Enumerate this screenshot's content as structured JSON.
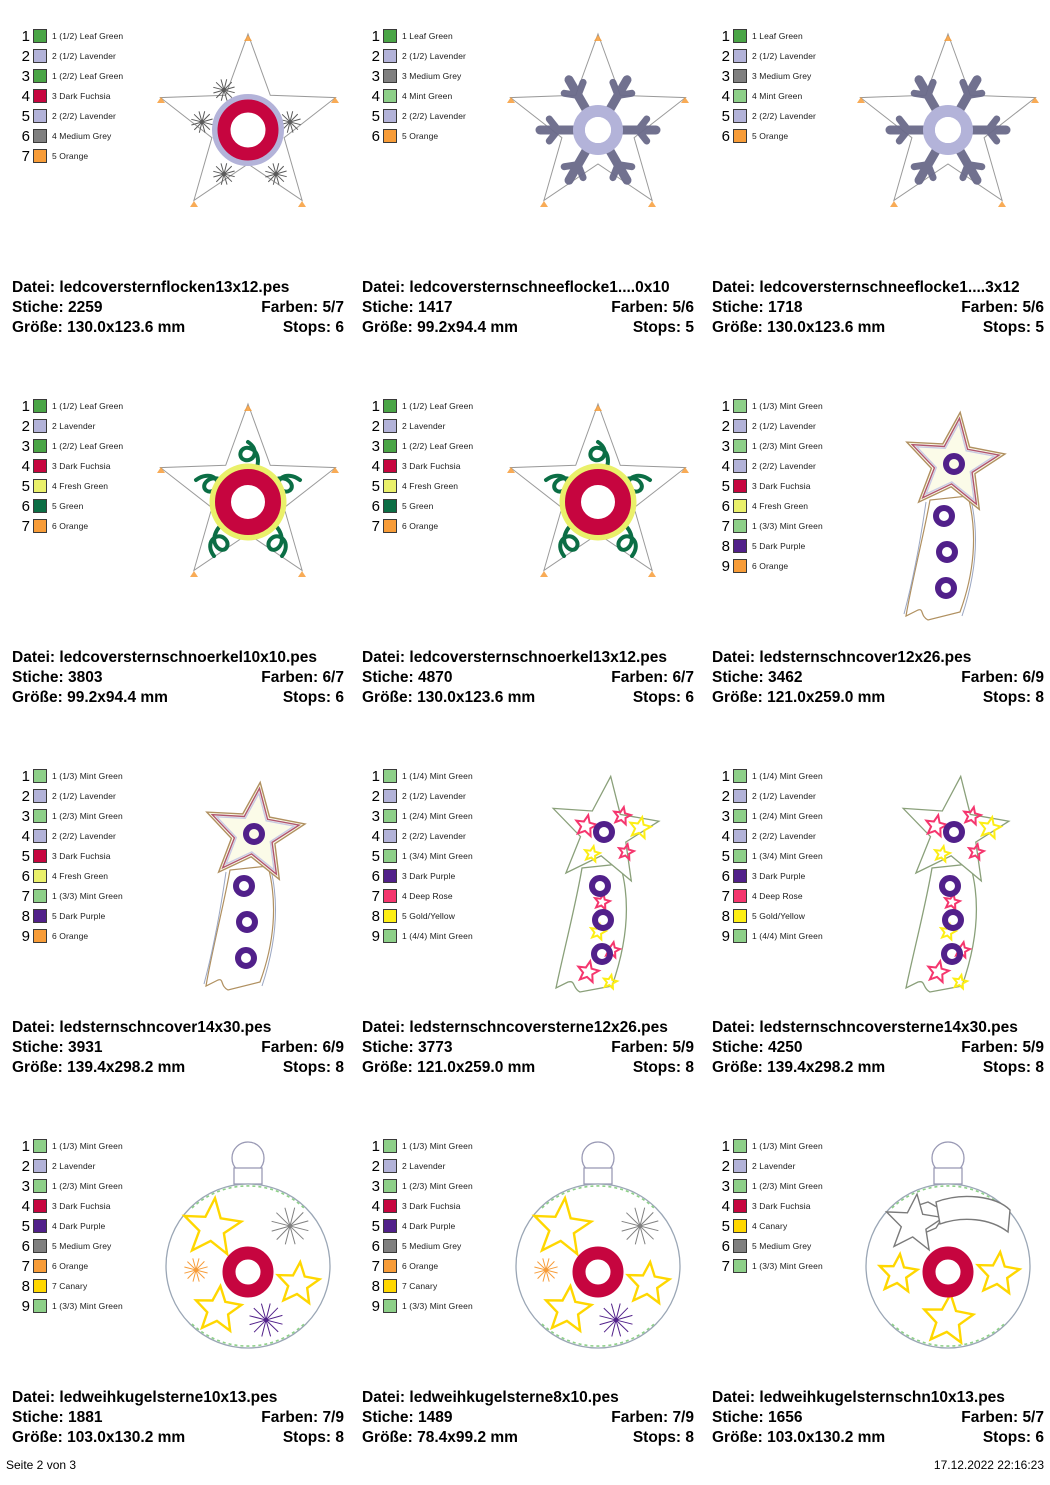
{
  "footer": {
    "page": "Seite 2 von 3",
    "timestamp": "17.12.2022 22:16:23"
  },
  "labels": {
    "file": "Datei:",
    "stitches": "Stiche:",
    "colors": "Farben:",
    "size": "Größe:",
    "stops": "Stops:"
  },
  "palette": {
    "leaf_green": "#4aa546",
    "mint_green": "#8ed089",
    "lavender": "#b3b3d9",
    "medium_grey": "#808080",
    "dark_fuchsia": "#c6053f",
    "fresh_green": "#eaf06a",
    "green": "#0b6e45",
    "dark_purple": "#51208a",
    "orange": "#f79c38",
    "deep_rose": "#f5366e",
    "gold_yellow": "#fdee14",
    "canary": "#ffd700"
  },
  "designs": [
    {
      "art": "star-flakes",
      "file": "ledcoversternflocken13x12.pes",
      "stitches": "2259",
      "colors": "5/7",
      "size": "130.0x123.6 mm",
      "stops": "6",
      "legend": [
        {
          "n": "1",
          "color": "#4aa546",
          "text": "1 (1/2) Leaf Green"
        },
        {
          "n": "2",
          "color": "#b3b3d9",
          "text": "2 (1/2) Lavender"
        },
        {
          "n": "3",
          "color": "#4aa546",
          "text": "1 (2/2) Leaf Green"
        },
        {
          "n": "4",
          "color": "#c6053f",
          "text": "3 Dark Fuchsia"
        },
        {
          "n": "5",
          "color": "#b3b3d9",
          "text": "2 (2/2) Lavender"
        },
        {
          "n": "6",
          "color": "#808080",
          "text": "4 Medium Grey"
        },
        {
          "n": "7",
          "color": "#f79c38",
          "text": "5 Orange"
        }
      ]
    },
    {
      "art": "star-snowflake",
      "file": "ledcoversternschneeflocke1....0x10",
      "stitches": "1417",
      "colors": "5/6",
      "size": "99.2x94.4 mm",
      "stops": "5",
      "legend": [
        {
          "n": "1",
          "color": "#4aa546",
          "text": "1 Leaf Green"
        },
        {
          "n": "2",
          "color": "#b3b3d9",
          "text": "2 (1/2) Lavender"
        },
        {
          "n": "3",
          "color": "#808080",
          "text": "3 Medium Grey"
        },
        {
          "n": "4",
          "color": "#8ed089",
          "text": "4 Mint Green"
        },
        {
          "n": "5",
          "color": "#b3b3d9",
          "text": "2 (2/2) Lavender"
        },
        {
          "n": "6",
          "color": "#f79c38",
          "text": "5 Orange"
        }
      ]
    },
    {
      "art": "star-snowflake",
      "file": "ledcoversternschneeflocke1....3x12",
      "stitches": "1718",
      "colors": "5/6",
      "size": "130.0x123.6 mm",
      "stops": "5",
      "legend": [
        {
          "n": "1",
          "color": "#4aa546",
          "text": "1 Leaf Green"
        },
        {
          "n": "2",
          "color": "#b3b3d9",
          "text": "2 (1/2) Lavender"
        },
        {
          "n": "3",
          "color": "#808080",
          "text": "3 Medium Grey"
        },
        {
          "n": "4",
          "color": "#8ed089",
          "text": "4 Mint Green"
        },
        {
          "n": "5",
          "color": "#b3b3d9",
          "text": "2 (2/2) Lavender"
        },
        {
          "n": "6",
          "color": "#f79c38",
          "text": "5 Orange"
        }
      ]
    },
    {
      "art": "star-swirls",
      "file": "ledcoversternschnoerkel10x10.pes",
      "stitches": "3803",
      "colors": "6/7",
      "size": "99.2x94.4 mm",
      "stops": "6",
      "legend": [
        {
          "n": "1",
          "color": "#4aa546",
          "text": "1 (1/2) Leaf Green"
        },
        {
          "n": "2",
          "color": "#b3b3d9",
          "text": "2 Lavender"
        },
        {
          "n": "3",
          "color": "#4aa546",
          "text": "1 (2/2) Leaf Green"
        },
        {
          "n": "4",
          "color": "#c6053f",
          "text": "3 Dark Fuchsia"
        },
        {
          "n": "5",
          "color": "#eaf06a",
          "text": "4 Fresh Green"
        },
        {
          "n": "6",
          "color": "#0b6e45",
          "text": "5 Green"
        },
        {
          "n": "7",
          "color": "#f79c38",
          "text": "6 Orange"
        }
      ]
    },
    {
      "art": "star-swirls",
      "file": "ledcoversternschnoerkel13x12.pes",
      "stitches": "4870",
      "colors": "6/7",
      "size": "130.0x123.6 mm",
      "stops": "6",
      "legend": [
        {
          "n": "1",
          "color": "#4aa546",
          "text": "1 (1/2) Leaf Green"
        },
        {
          "n": "2",
          "color": "#b3b3d9",
          "text": "2 Lavender"
        },
        {
          "n": "3",
          "color": "#4aa546",
          "text": "1 (2/2) Leaf Green"
        },
        {
          "n": "4",
          "color": "#c6053f",
          "text": "3 Dark Fuchsia"
        },
        {
          "n": "5",
          "color": "#eaf06a",
          "text": "4 Fresh Green"
        },
        {
          "n": "6",
          "color": "#0b6e45",
          "text": "5 Green"
        },
        {
          "n": "7",
          "color": "#f79c38",
          "text": "6 Orange"
        }
      ]
    },
    {
      "art": "shooting-star-plain",
      "file": "ledsternschncover12x26.pes",
      "stitches": "3462",
      "colors": "6/9",
      "size": "121.0x259.0 mm",
      "stops": "8",
      "legend": [
        {
          "n": "1",
          "color": "#8ed089",
          "text": "1 (1/3) Mint Green"
        },
        {
          "n": "2",
          "color": "#b3b3d9",
          "text": "2 (1/2) Lavender"
        },
        {
          "n": "3",
          "color": "#8ed089",
          "text": "1 (2/3) Mint Green"
        },
        {
          "n": "4",
          "color": "#b3b3d9",
          "text": "2 (2/2) Lavender"
        },
        {
          "n": "5",
          "color": "#c6053f",
          "text": "3 Dark Fuchsia"
        },
        {
          "n": "6",
          "color": "#eaf06a",
          "text": "4 Fresh Green"
        },
        {
          "n": "7",
          "color": "#8ed089",
          "text": "1 (3/3) Mint Green"
        },
        {
          "n": "8",
          "color": "#51208a",
          "text": "5 Dark Purple"
        },
        {
          "n": "9",
          "color": "#f79c38",
          "text": "6 Orange"
        }
      ]
    },
    {
      "art": "shooting-star-plain",
      "file": "ledsternschncover14x30.pes",
      "stitches": "3931",
      "colors": "6/9",
      "size": "139.4x298.2 mm",
      "stops": "8",
      "legend": [
        {
          "n": "1",
          "color": "#8ed089",
          "text": "1 (1/3) Mint Green"
        },
        {
          "n": "2",
          "color": "#b3b3d9",
          "text": "2 (1/2) Lavender"
        },
        {
          "n": "3",
          "color": "#8ed089",
          "text": "1 (2/3) Mint Green"
        },
        {
          "n": "4",
          "color": "#b3b3d9",
          "text": "2 (2/2) Lavender"
        },
        {
          "n": "5",
          "color": "#c6053f",
          "text": "3 Dark Fuchsia"
        },
        {
          "n": "6",
          "color": "#eaf06a",
          "text": "4 Fresh Green"
        },
        {
          "n": "7",
          "color": "#8ed089",
          "text": "1 (3/3) Mint Green"
        },
        {
          "n": "8",
          "color": "#51208a",
          "text": "5 Dark Purple"
        },
        {
          "n": "9",
          "color": "#f79c38",
          "text": "6 Orange"
        }
      ]
    },
    {
      "art": "shooting-star-stars",
      "file": "ledsternschncoversterne12x26.pes",
      "stitches": "3773",
      "colors": "5/9",
      "size": "121.0x259.0 mm",
      "stops": "8",
      "legend": [
        {
          "n": "1",
          "color": "#8ed089",
          "text": "1 (1/4) Mint Green"
        },
        {
          "n": "2",
          "color": "#b3b3d9",
          "text": "2 (1/2) Lavender"
        },
        {
          "n": "3",
          "color": "#8ed089",
          "text": "1 (2/4) Mint Green"
        },
        {
          "n": "4",
          "color": "#b3b3d9",
          "text": "2 (2/2) Lavender"
        },
        {
          "n": "5",
          "color": "#8ed089",
          "text": "1 (3/4) Mint Green"
        },
        {
          "n": "6",
          "color": "#51208a",
          "text": "3 Dark Purple"
        },
        {
          "n": "7",
          "color": "#f5366e",
          "text": "4 Deep Rose"
        },
        {
          "n": "8",
          "color": "#fdee14",
          "text": "5 Gold/Yellow"
        },
        {
          "n": "9",
          "color": "#8ed089",
          "text": "1 (4/4) Mint Green"
        }
      ]
    },
    {
      "art": "shooting-star-stars",
      "file": "ledsternschncoversterne14x30.pes",
      "stitches": "4250",
      "colors": "5/9",
      "size": "139.4x298.2 mm",
      "stops": "8",
      "legend": [
        {
          "n": "1",
          "color": "#8ed089",
          "text": "1 (1/4) Mint Green"
        },
        {
          "n": "2",
          "color": "#b3b3d9",
          "text": "2 (1/2) Lavender"
        },
        {
          "n": "3",
          "color": "#8ed089",
          "text": "1 (2/4) Mint Green"
        },
        {
          "n": "4",
          "color": "#b3b3d9",
          "text": "2 (2/2) Lavender"
        },
        {
          "n": "5",
          "color": "#8ed089",
          "text": "1 (3/4) Mint Green"
        },
        {
          "n": "6",
          "color": "#51208a",
          "text": "3 Dark Purple"
        },
        {
          "n": "7",
          "color": "#f5366e",
          "text": "4 Deep Rose"
        },
        {
          "n": "8",
          "color": "#fdee14",
          "text": "5 Gold/Yellow"
        },
        {
          "n": "9",
          "color": "#8ed089",
          "text": "1 (4/4) Mint Green"
        }
      ]
    },
    {
      "art": "bauble-stars",
      "file": "ledweihkugelsterne10x13.pes",
      "stitches": "1881",
      "colors": "7/9",
      "size": "103.0x130.2 mm",
      "stops": "8",
      "legend": [
        {
          "n": "1",
          "color": "#8ed089",
          "text": "1 (1/3) Mint Green"
        },
        {
          "n": "2",
          "color": "#b3b3d9",
          "text": "2 Lavender"
        },
        {
          "n": "3",
          "color": "#8ed089",
          "text": "1 (2/3) Mint Green"
        },
        {
          "n": "4",
          "color": "#c6053f",
          "text": "3 Dark Fuchsia"
        },
        {
          "n": "5",
          "color": "#51208a",
          "text": "4 Dark Purple"
        },
        {
          "n": "6",
          "color": "#808080",
          "text": "5 Medium Grey"
        },
        {
          "n": "7",
          "color": "#f79c38",
          "text": "6 Orange"
        },
        {
          "n": "8",
          "color": "#ffd700",
          "text": "7 Canary"
        },
        {
          "n": "9",
          "color": "#8ed089",
          "text": "1 (3/3) Mint Green"
        }
      ]
    },
    {
      "art": "bauble-stars",
      "file": "ledweihkugelsterne8x10.pes",
      "stitches": "1489",
      "colors": "7/9",
      "size": "78.4x99.2 mm",
      "stops": "8",
      "legend": [
        {
          "n": "1",
          "color": "#8ed089",
          "text": "1 (1/3) Mint Green"
        },
        {
          "n": "2",
          "color": "#b3b3d9",
          "text": "2 Lavender"
        },
        {
          "n": "3",
          "color": "#8ed089",
          "text": "1 (2/3) Mint Green"
        },
        {
          "n": "4",
          "color": "#c6053f",
          "text": "3 Dark Fuchsia"
        },
        {
          "n": "5",
          "color": "#51208a",
          "text": "4 Dark Purple"
        },
        {
          "n": "6",
          "color": "#808080",
          "text": "5 Medium Grey"
        },
        {
          "n": "7",
          "color": "#f79c38",
          "text": "6 Orange"
        },
        {
          "n": "8",
          "color": "#ffd700",
          "text": "7 Canary"
        },
        {
          "n": "9",
          "color": "#8ed089",
          "text": "1 (3/3) Mint Green"
        }
      ]
    },
    {
      "art": "bauble-shooting-star",
      "file": "ledweihkugelsternschn10x13.pes",
      "stitches": "1656",
      "colors": "5/7",
      "size": "103.0x130.2 mm",
      "stops": "6",
      "legend": [
        {
          "n": "1",
          "color": "#8ed089",
          "text": "1 (1/3) Mint Green"
        },
        {
          "n": "2",
          "color": "#b3b3d9",
          "text": "2 Lavender"
        },
        {
          "n": "3",
          "color": "#8ed089",
          "text": "1 (2/3) Mint Green"
        },
        {
          "n": "4",
          "color": "#c6053f",
          "text": "3 Dark Fuchsia"
        },
        {
          "n": "5",
          "color": "#ffd700",
          "text": "4 Canary"
        },
        {
          "n": "6",
          "color": "#808080",
          "text": "5 Medium Grey"
        },
        {
          "n": "7",
          "color": "#8ed089",
          "text": "1 (3/3) Mint Green"
        }
      ]
    }
  ]
}
